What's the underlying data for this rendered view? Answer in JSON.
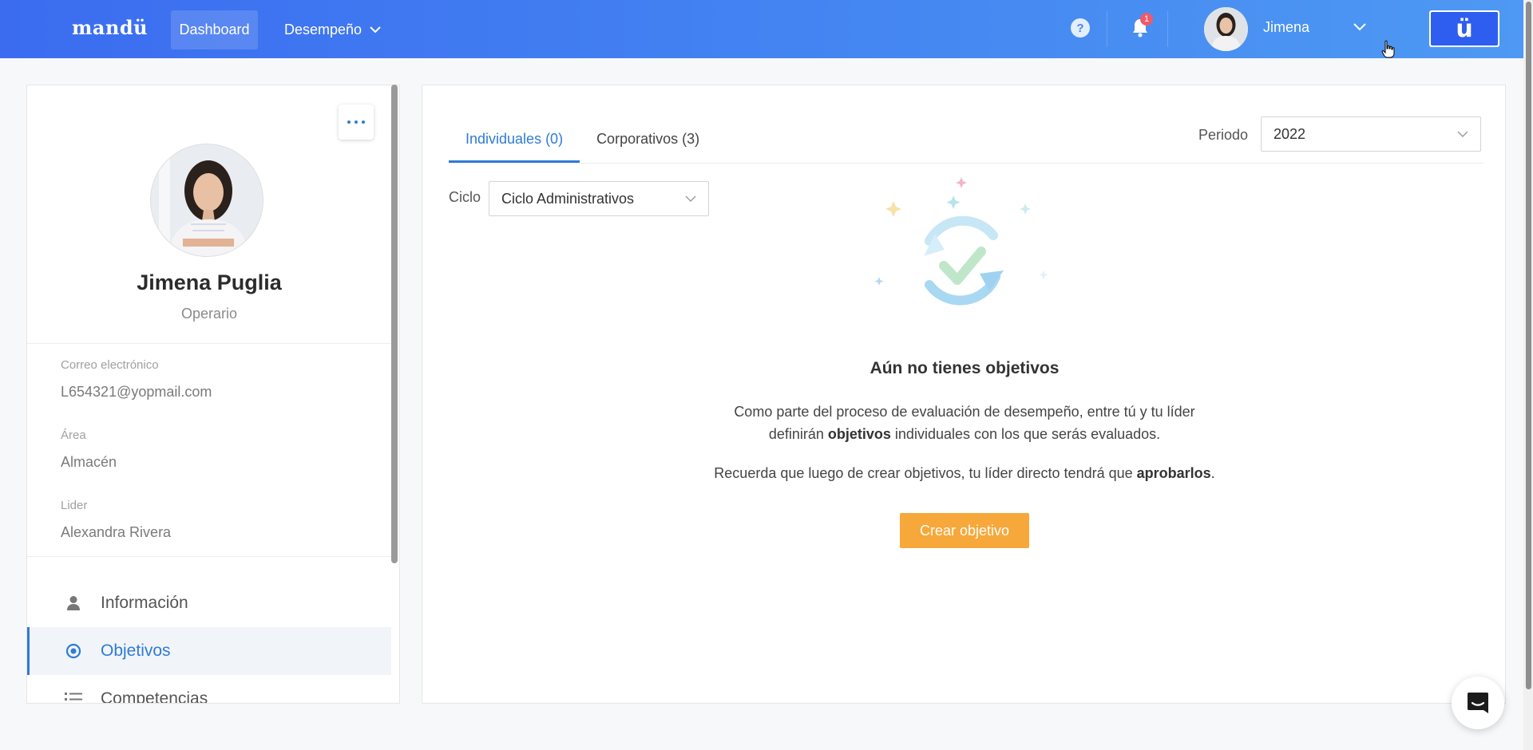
{
  "header": {
    "logo": "mandü",
    "nav": {
      "dashboard": "Dashboard",
      "desempeno": "Desempeño"
    },
    "help": "?",
    "notifications_count": "1",
    "user_name": "Jimena",
    "brand_mark": "ü"
  },
  "profile": {
    "name": "Jimena Puglia",
    "role": "Operario",
    "fields": {
      "email_label": "Correo electrónico",
      "email_value": "L654321@yopmail.com",
      "area_label": "Área",
      "area_value": "Almacén",
      "leader_label": "Lider",
      "leader_value": "Alexandra Rivera"
    },
    "menu": [
      {
        "label": "Información",
        "icon": "user-icon",
        "active": false
      },
      {
        "label": "Objetivos",
        "icon": "target-icon",
        "active": true
      },
      {
        "label": "Competencias",
        "icon": "list-icon",
        "active": false
      }
    ]
  },
  "main": {
    "tabs": [
      {
        "label": "Individuales (0)",
        "active": true
      },
      {
        "label": "Corporativos (3)",
        "active": false
      }
    ],
    "period_label": "Periodo",
    "period_value": "2022",
    "cycle_label": "Ciclo",
    "cycle_value": "Ciclo Administrativos",
    "empty": {
      "title": "Aún no tienes objetivos",
      "line1": "Como parte del proceso de evaluación de desempeño, entre tú y tu líder",
      "line2_pre": "definirán ",
      "line2_bold": "objetivos",
      "line2_post": " individuales con los que serás evaluados.",
      "line3_pre": "Recuerda que luego de crear objetivos, tu líder directo tendrá que ",
      "line3_bold": "aprobarlos",
      "line3_post": "."
    },
    "create_button": "Crear objetivo"
  },
  "colors": {
    "primary": "#2f7bd6",
    "header_start": "#3b6cf0",
    "header_end": "#4e99f3",
    "accent_button": "#f7a83a",
    "badge": "#f05a6a"
  }
}
